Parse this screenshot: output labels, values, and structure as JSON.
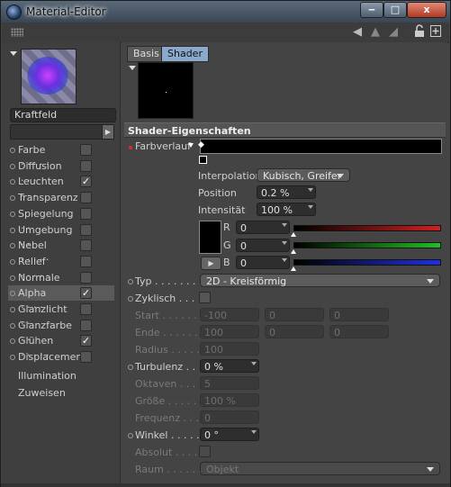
{
  "window": {
    "title": "Material-Editor",
    "close_label": "x"
  },
  "toolbar": {
    "icons": [
      "grip-icon",
      "back-arrow-icon",
      "up-arrow-icon",
      "forward-arrow-icon",
      "lock-icon",
      "new-window-icon"
    ]
  },
  "material": {
    "name": "Kraftfeld"
  },
  "channels": [
    {
      "label": "Farbe",
      "dots": ". . . . .",
      "checked": false,
      "selected": false
    },
    {
      "label": "Diffusion",
      "dots": ". . .",
      "checked": false,
      "selected": false
    },
    {
      "label": "Leuchten",
      "dots": ". . .",
      "checked": true,
      "selected": false
    },
    {
      "label": "Transparenz",
      "dots": "",
      "checked": false,
      "selected": false
    },
    {
      "label": "Spiegelung",
      "dots": ". .",
      "checked": false,
      "selected": false
    },
    {
      "label": "Umgebung",
      "dots": ". .",
      "checked": false,
      "selected": false
    },
    {
      "label": "Nebel",
      "dots": ". . . . .",
      "checked": false,
      "selected": false
    },
    {
      "label": "Relief",
      "dots": ". . . . .",
      "checked": false,
      "selected": false
    },
    {
      "label": "Normale",
      "dots": ". . .",
      "checked": false,
      "selected": false
    },
    {
      "label": "Alpha",
      "dots": ". . . . .",
      "checked": true,
      "selected": true
    },
    {
      "label": "Glanzlicht",
      "dots": ". .",
      "checked": false,
      "selected": false
    },
    {
      "label": "Glanzfarbe",
      "dots": ". .",
      "checked": false,
      "selected": false
    },
    {
      "label": "Glühen",
      "dots": ". . . . .",
      "checked": true,
      "selected": false
    },
    {
      "label": "Displacement",
      "dots": "",
      "checked": false,
      "selected": false
    }
  ],
  "extra_items": [
    "Illumination",
    "Zuweisen"
  ],
  "tabs": [
    "Basis",
    "Shader"
  ],
  "section_title": "Shader-Eigenschaften",
  "farbverlauf_label": "Farbverlauf",
  "interpolation": {
    "label": "Interpolation",
    "value": "Kubisch, Greifer"
  },
  "position": {
    "label": "Position",
    "value": "0.2 %"
  },
  "intensitaet": {
    "label": "Intensität",
    "value": "100 %"
  },
  "rgb": [
    {
      "label": "R",
      "value": "0",
      "color": "#d02020"
    },
    {
      "label": "G",
      "value": "0",
      "color": "#20c020"
    },
    {
      "label": "B",
      "value": "0",
      "color": "#2030e0"
    }
  ],
  "typ": {
    "label": "Typ",
    "dots": ". . . . . . . .",
    "value": "2D - Kreisförmig"
  },
  "zyklisch": {
    "label": "Zyklisch",
    "dots": ". . . . ."
  },
  "start": {
    "label": "Start",
    "dots": ". . . . . . . .",
    "values": [
      "-100",
      "0",
      "0"
    ]
  },
  "ende": {
    "label": "Ende",
    "dots": ". . . . . . . .",
    "values": [
      "100",
      "0",
      "0"
    ]
  },
  "radius": {
    "label": "Radius",
    "dots": ". . . . . .",
    "value": "100"
  },
  "turbulenz": {
    "label": "Turbulenz",
    "dots": ". .",
    "value": "0 %"
  },
  "oktaven": {
    "label": "Oktaven",
    "dots": ". . . .",
    "value": "5"
  },
  "groesse": {
    "label": "Größe",
    "dots": ". . . . . . .",
    "value": "100 %"
  },
  "frequenz": {
    "label": "Frequenz",
    "dots": ". . . .",
    "value": "0"
  },
  "winkel": {
    "label": "Winkel",
    "dots": ". . . . . .",
    "value": "0 °"
  },
  "absolut": {
    "label": "Absolut",
    "dots": ". . . . ."
  },
  "raum": {
    "label": "Raum",
    "dots": ". . . . . . .",
    "value": "Objekt"
  }
}
